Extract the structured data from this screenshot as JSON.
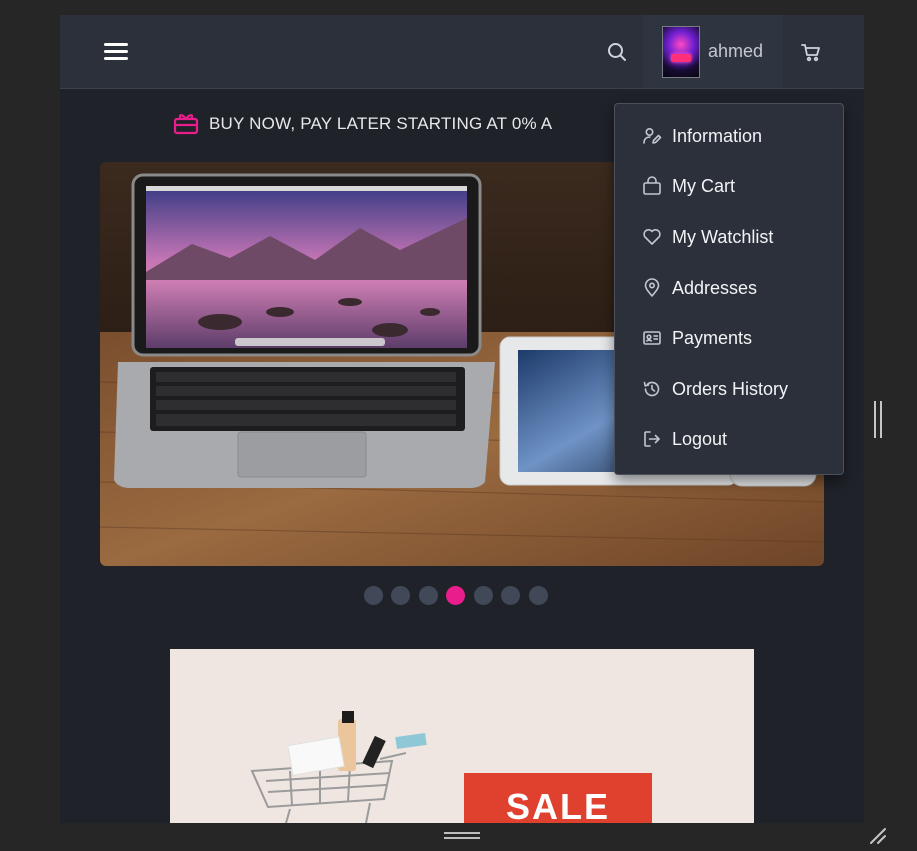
{
  "header": {
    "menu_icon": "hamburger-icon",
    "search_icon": "search-icon",
    "username": "ahmed",
    "cart_icon": "cart-icon"
  },
  "promo": {
    "icon": "gift-icon",
    "text": "BUY NOW, PAY LATER STARTING AT 0% A"
  },
  "user_menu": {
    "items": [
      {
        "label": "Information",
        "icon": "user-edit-icon"
      },
      {
        "label": "My Cart",
        "icon": "shopping-bag-icon"
      },
      {
        "label": "My Watchlist",
        "icon": "heart-icon"
      },
      {
        "label": "Addresses",
        "icon": "map-pin-icon"
      },
      {
        "label": "Payments",
        "icon": "id-card-icon"
      },
      {
        "label": "Orders History",
        "icon": "history-icon"
      },
      {
        "label": "Logout",
        "icon": "logout-icon"
      }
    ]
  },
  "carousel": {
    "slide_count": 7,
    "active_index": 3
  },
  "banner": {
    "sale_text": "SALE"
  },
  "colors": {
    "accent": "#e91e8c",
    "navbar": "#2b303b",
    "page_bg": "#1f2229",
    "dot_inactive": "#414858",
    "menu_text": "#f2f3f5"
  }
}
